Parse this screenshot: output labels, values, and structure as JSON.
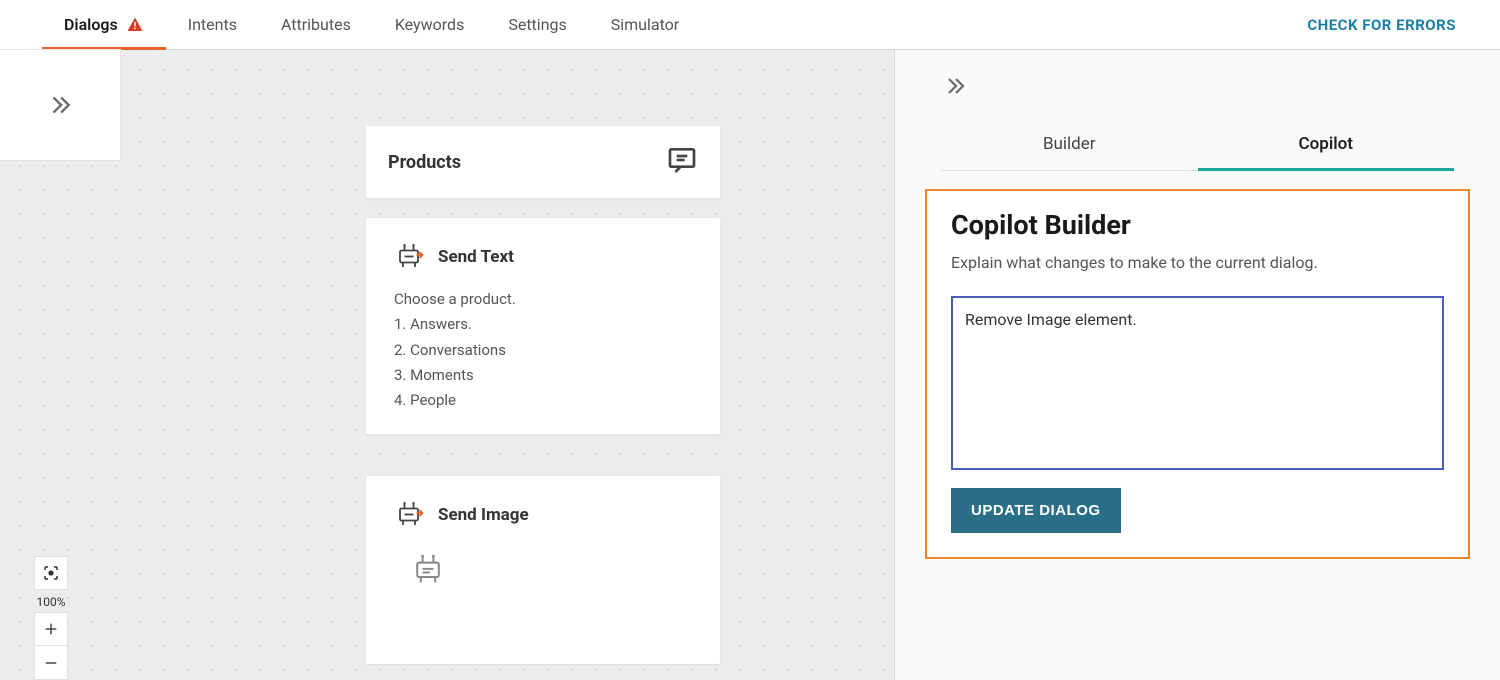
{
  "topbar": {
    "tabs": [
      {
        "label": "Dialogs",
        "active": true,
        "warning": true
      },
      {
        "label": "Intents"
      },
      {
        "label": "Attributes"
      },
      {
        "label": "Keywords"
      },
      {
        "label": "Settings"
      },
      {
        "label": "Simulator"
      }
    ],
    "check_errors": "CHECK FOR ERRORS"
  },
  "canvas": {
    "products_node": {
      "title": "Products"
    },
    "send_text": {
      "title": "Send Text",
      "lines": [
        "Choose a product.",
        "1. Answers.",
        "2. Conversations",
        "3. Moments",
        "4. People"
      ]
    },
    "send_image": {
      "title": "Send Image"
    },
    "zoom": {
      "pct": "100%"
    }
  },
  "panel": {
    "tabs": {
      "builder": "Builder",
      "copilot": "Copilot"
    },
    "copilot": {
      "title": "Copilot Builder",
      "desc": "Explain what changes to make to the current dialog.",
      "input_value": "Remove Image element.",
      "button": "UPDATE DIALOG"
    }
  },
  "icons": {
    "chat": "chat-bubble-icon",
    "bot": "bot-icon",
    "warning": "warning-icon",
    "expand": "chevron-double-right-icon",
    "center": "center-focus-icon",
    "plus": "plus-icon",
    "minus": "minus-icon"
  }
}
